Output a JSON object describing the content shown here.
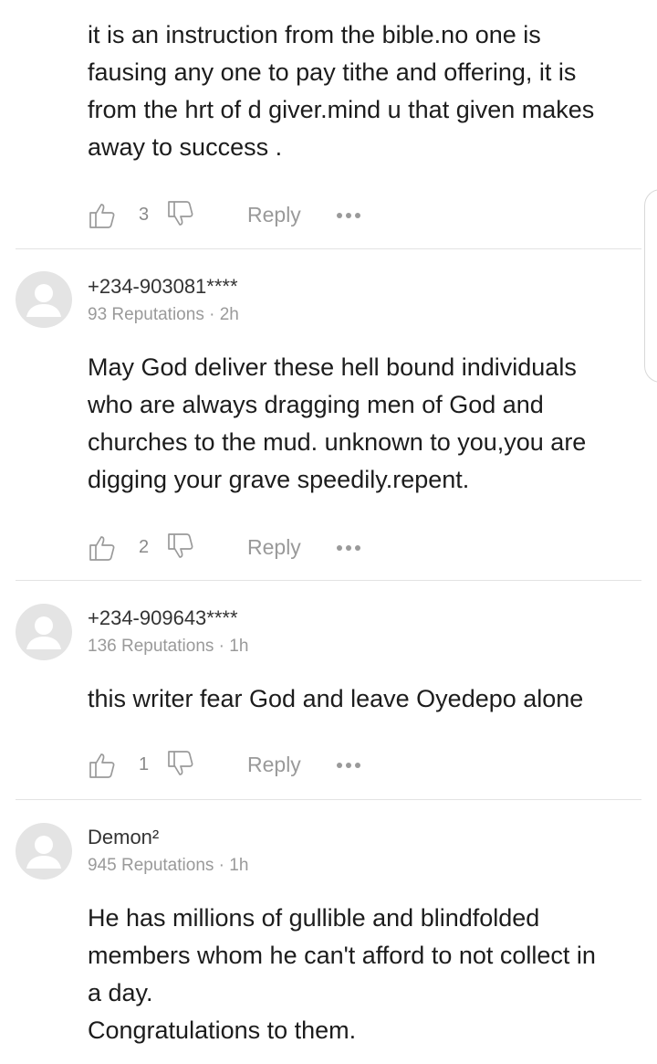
{
  "comments": [
    {
      "author": "",
      "meta": "",
      "text": "it is an instruction from the  bible.no one is\nfausing any one to pay tithe and offering, it is\nfrom the hrt of d giver.mind u that given makes\naway to success .",
      "likes": "3",
      "reply_label": "Reply"
    },
    {
      "author": "+234-903081****",
      "meta": "93 Reputations · 2h",
      "text": "May God deliver these hell bound individuals\nwho are always dragging men of God and\nchurches to the mud. unknown to you,you are\ndigging your grave speedily.repent.",
      "likes": "2",
      "reply_label": "Reply"
    },
    {
      "author": "+234-909643****",
      "meta": "136 Reputations · 1h",
      "text": "this writer fear God and leave Oyedepo alone",
      "likes": "1",
      "reply_label": "Reply"
    },
    {
      "author": "Demon²",
      "meta": "945 Reputations · 1h",
      "text": "He has millions of gullible and blindfolded\nmembers whom he can't afford to not collect in\na day.\nCongratulations to them.",
      "likes": "",
      "reply_label": ""
    }
  ],
  "icons": {
    "like": "thumbs-up-outline-icon",
    "dislike": "thumbs-down-outline-icon",
    "more": "more-horizontal-icon",
    "avatar": "default-user-avatar-icon"
  },
  "colors": {
    "text": "#1c1c1c",
    "meta": "#9a9a9a",
    "avatar_bg": "#e4e4e4",
    "divider": "#e3e3e3"
  }
}
